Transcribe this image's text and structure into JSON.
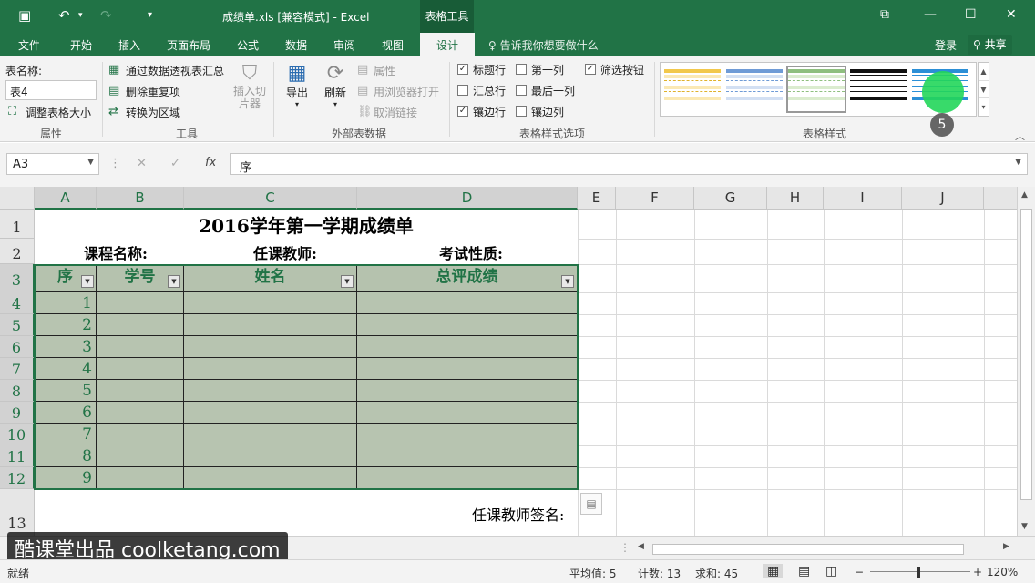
{
  "window": {
    "title": "成绩单.xls  [兼容模式] - Excel",
    "contextual_tab": "表格工具"
  },
  "ribbon_tabs": [
    "文件",
    "开始",
    "插入",
    "页面布局",
    "公式",
    "数据",
    "审阅",
    "视图",
    "设计"
  ],
  "active_tab": "设计",
  "tell_me": "告诉我你想要做什么",
  "login": "登录",
  "share": "共享",
  "groups": {
    "properties": {
      "label": "属性",
      "table_name_label": "表名称:",
      "table_name_value": "表4",
      "resize": "调整表格大小"
    },
    "tools": {
      "label": "工具",
      "pivot": "通过数据透视表汇总",
      "remove_dup": "删除重复项",
      "convert": "转换为区域",
      "slicer": "插入切片器"
    },
    "external": {
      "label": "外部表数据",
      "export": "导出",
      "refresh": "刷新",
      "properties": "属性",
      "open_browser": "用浏览器打开",
      "unlink": "取消链接"
    },
    "style_options": {
      "label": "表格样式选项",
      "items": [
        {
          "label": "标题行",
          "checked": true
        },
        {
          "label": "第一列",
          "checked": false
        },
        {
          "label": "筛选按钮",
          "checked": true
        },
        {
          "label": "汇总行",
          "checked": false
        },
        {
          "label": "最后一列",
          "checked": false
        },
        {
          "label": "镶边行",
          "checked": true
        },
        {
          "label": "镶边列",
          "checked": false
        }
      ]
    },
    "table_styles": {
      "label": "表格样式",
      "swatches": [
        "#f2c84b",
        "#6f9bd6",
        "#8fbf7f",
        "#222222",
        "#2b8fd6"
      ]
    }
  },
  "step_badge": "5",
  "formula_bar": {
    "name_box": "A3",
    "fx": "fx",
    "content": "序"
  },
  "columns": [
    "A",
    "B",
    "C",
    "D",
    "E",
    "F",
    "G",
    "H",
    "I",
    "J"
  ],
  "rows": [
    "1",
    "2",
    "3",
    "4",
    "5",
    "6",
    "7",
    "8",
    "9",
    "10",
    "11",
    "12",
    "13"
  ],
  "sheet": {
    "title": "2016学年第一学期成绩单",
    "course_label": "课程名称:",
    "teacher_label": "任课教师:",
    "exam_label": "考试性质:",
    "headers": [
      "序",
      "学号",
      "姓名",
      "总评成绩"
    ],
    "seq": [
      "1",
      "2",
      "3",
      "4",
      "5",
      "6",
      "7",
      "8",
      "9"
    ],
    "signature": "任课教师签名:"
  },
  "watermark": "酷课堂出品 coolketang.com",
  "status": {
    "ready": "就绪",
    "average": "平均值: 5",
    "count": "计数: 13",
    "sum": "求和: 45",
    "zoom": "120%"
  },
  "colors": {
    "excel_green": "#217346",
    "table_fill": "#b7c4b0",
    "header_text": "#217346"
  }
}
